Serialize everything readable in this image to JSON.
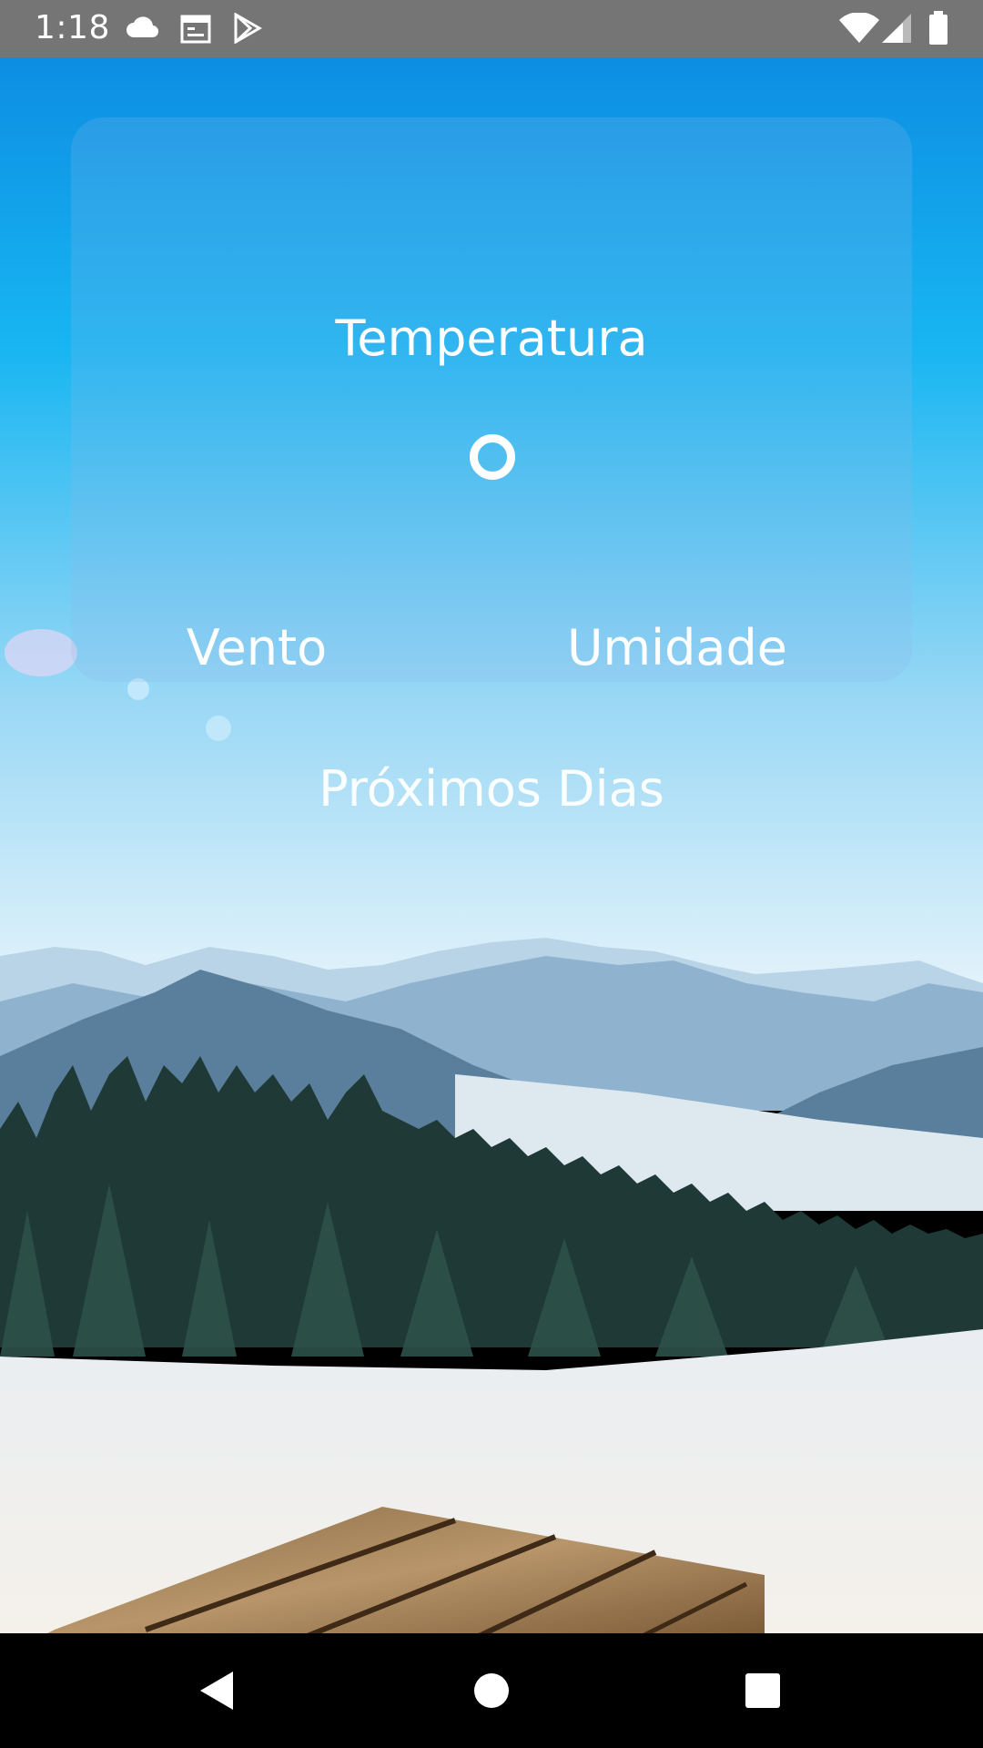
{
  "status_bar": {
    "time": "1:18",
    "left_icons": [
      "cloud-icon",
      "calendar-icon",
      "play-store-icon"
    ],
    "right_icons": [
      "wifi-icon",
      "cell-signal-icon",
      "battery-icon"
    ]
  },
  "card": {
    "title": "Temperatura",
    "loading_indicator": "loading-ring-icon",
    "wind_label": "Vento",
    "humidity_label": "Umidade"
  },
  "forecast": {
    "heading": "Próximos Dias"
  },
  "nav_bar": {
    "buttons": [
      "back-icon",
      "home-icon",
      "recents-icon"
    ]
  },
  "colors": {
    "status_bar": "#757575",
    "sky_top": "#0a8ee3",
    "sky_bottom": "#dff3ff",
    "snow": "#f3f1ee",
    "text": "#ffffff"
  }
}
